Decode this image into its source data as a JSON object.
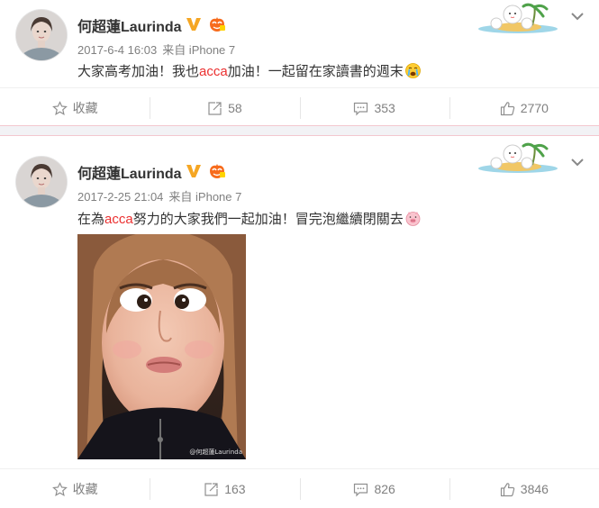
{
  "posts": [
    {
      "username": "何超蓮Laurinda",
      "timestamp": "2017-6-4 16:03",
      "source": "来自 iPhone 7",
      "text_before": "大家高考加油！我也",
      "text_highlight": "acca",
      "text_after": "加油！一起留在家讀書的週末",
      "emoji": "crying-face",
      "actions": {
        "favorite": "收藏",
        "repost": "58",
        "comment": "353",
        "like": "2770"
      }
    },
    {
      "username": "何超蓮Laurinda",
      "timestamp": "2017-2-25 21:04",
      "source": "来自 iPhone 7",
      "text_before": "在為",
      "text_highlight": "acca",
      "text_after": "努力的大家我們一起加油！冒完泡繼續閉關去",
      "emoji": "pig-face",
      "image_watermark": "@何超蓮Laurinda",
      "actions": {
        "favorite": "收藏",
        "repost": "163",
        "comment": "826",
        "like": "3846"
      }
    }
  ],
  "colors": {
    "highlight": "#eb3030",
    "verified": "#f5a623",
    "separator_border": "#f3c8cf",
    "action_text": "#808080"
  }
}
